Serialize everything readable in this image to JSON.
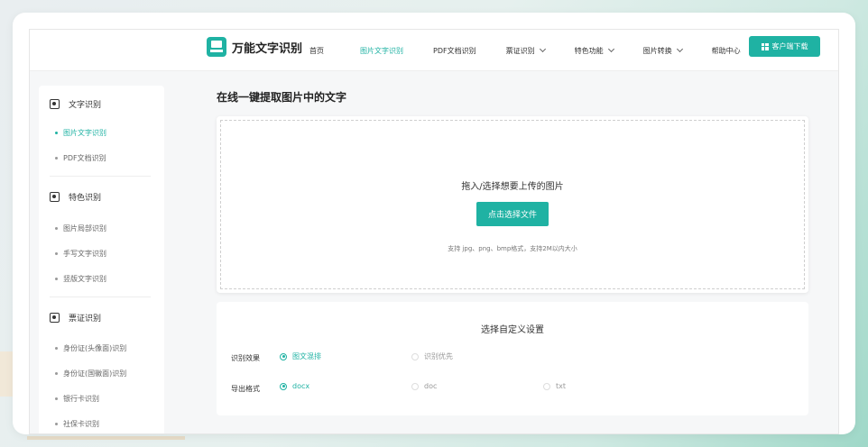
{
  "header": {
    "logo_text": "万能文字识别",
    "nav": [
      {
        "label": "首页",
        "dropdown": false,
        "active": false
      },
      {
        "label": "图片文字识别",
        "dropdown": false,
        "active": true
      },
      {
        "label": "PDF文档识别",
        "dropdown": false,
        "active": false
      },
      {
        "label": "票证识别",
        "dropdown": true,
        "active": false
      },
      {
        "label": "特色功能",
        "dropdown": true,
        "active": false
      },
      {
        "label": "图片转换",
        "dropdown": true,
        "active": false
      },
      {
        "label": "帮助中心",
        "dropdown": false,
        "active": false
      }
    ],
    "download_label": "客户端下载"
  },
  "sidebar": {
    "sections": [
      {
        "title": "文字识别",
        "icon": "text-scan-icon",
        "items": [
          "图片文字识别",
          "PDF文档识别"
        ]
      },
      {
        "title": "特色识别",
        "icon": "special-scan-icon",
        "items": [
          "图片局部识别",
          "手写文字识别",
          "竖版文字识别"
        ]
      },
      {
        "title": "票证识别",
        "icon": "card-scan-icon",
        "items": [
          "身份证(头像面)识别",
          "身份证(国徽面)识别",
          "银行卡识别",
          "社保卡识别"
        ]
      }
    ],
    "active_item": "图片文字识别"
  },
  "main": {
    "title": "在线一键提取图片中的文字",
    "upload": {
      "prompt": "拖入/选择想要上传的图片",
      "button": "点击选择文件",
      "hint": "支持 jpg、png、bmp格式，支持2M以内大小"
    },
    "settings": {
      "title": "选择自定义设置",
      "effect_label": "识别效果",
      "effect_options": [
        "图文混排",
        "识别优先"
      ],
      "effect_selected": "图文混排",
      "format_label": "导出格式",
      "format_options": [
        "docx",
        "doc",
        "txt"
      ],
      "format_selected": "docx"
    }
  },
  "colors": {
    "accent": "#1fb2a3"
  }
}
